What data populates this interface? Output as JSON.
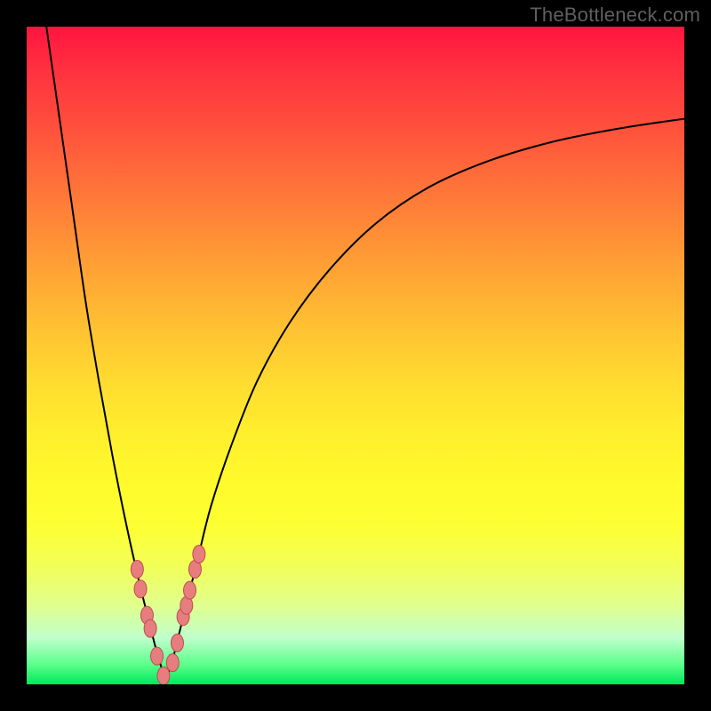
{
  "watermark": "TheBottleneck.com",
  "colors": {
    "frame": "#000000",
    "curve": "#000000",
    "marker_fill": "#e77d7e",
    "marker_stroke": "#b94f4f",
    "gradient_top": "#ff143f",
    "gradient_bottom": "#00e85c"
  },
  "chart_data": {
    "type": "line",
    "title": "",
    "xlabel": "",
    "ylabel": "",
    "xlim": [
      0,
      100
    ],
    "ylim": [
      0,
      100
    ],
    "grid": false,
    "legend": false,
    "notes": "Bottleneck-style V curve. Y ≈ bottleneck % (0 = no bottleneck at bottom, 100 = full bottleneck at top). X is an unlabeled component-rating axis. Minimum at x≈21. Left branch rises steeply toward 100; right branch rises asymptotically toward ~86.",
    "series": [
      {
        "name": "left_branch",
        "x": [
          3.0,
          5.0,
          7.0,
          9.0,
          11.0,
          13.0,
          15.0,
          17.0,
          18.5,
          19.5,
          20.5,
          21.0
        ],
        "y": [
          100.0,
          86.0,
          72.0,
          58.0,
          46.0,
          35.0,
          25.0,
          16.0,
          10.0,
          6.0,
          2.5,
          0.5
        ]
      },
      {
        "name": "right_branch",
        "x": [
          21.0,
          22.0,
          23.0,
          24.5,
          26.0,
          28.0,
          31.0,
          35.0,
          40.0,
          46.0,
          53.0,
          61.0,
          70.0,
          80.0,
          90.0,
          100.0
        ],
        "y": [
          0.5,
          3.0,
          7.0,
          13.0,
          19.0,
          27.0,
          36.0,
          46.0,
          55.0,
          63.0,
          70.0,
          75.5,
          79.5,
          82.5,
          84.5,
          86.0
        ]
      }
    ],
    "markers": {
      "name": "highlighted_points",
      "x": [
        16.8,
        17.3,
        18.3,
        18.8,
        19.8,
        20.8,
        22.2,
        22.9,
        23.8,
        24.3,
        24.8,
        25.6,
        26.2
      ],
      "y": [
        17.5,
        14.5,
        10.5,
        8.5,
        4.3,
        1.3,
        3.3,
        6.3,
        10.3,
        12.0,
        14.3,
        17.5,
        19.8
      ]
    }
  }
}
